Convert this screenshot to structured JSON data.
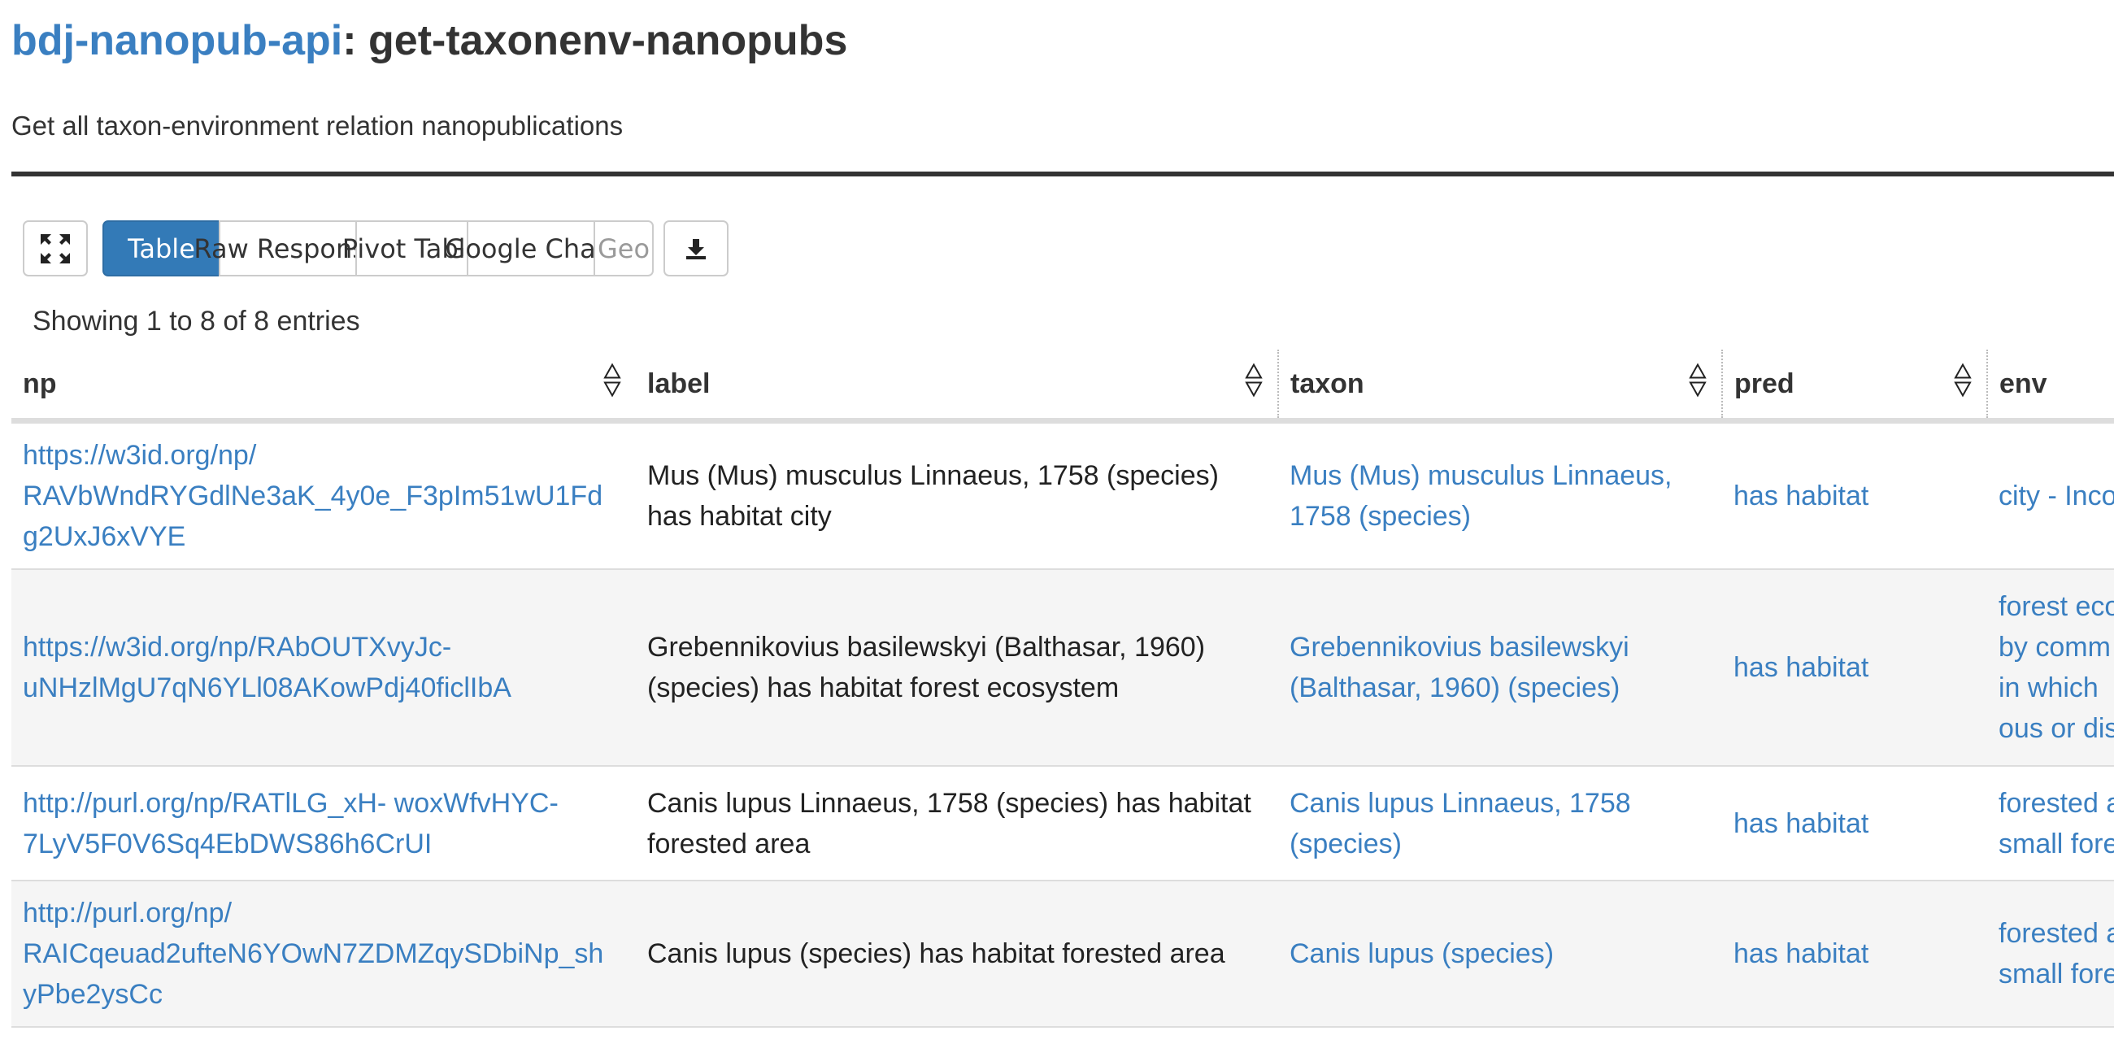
{
  "header": {
    "api_name": "bdj-nanopub-api",
    "separator": ": ",
    "query_name": "get-taxonenv-nanopubs",
    "description": "Get all taxon-environment relation nanopublications"
  },
  "toolbar": {
    "fullscreen_icon": "expand-arrows-icon",
    "tabs": [
      "Table",
      "Raw Response",
      "Pivot Table",
      "Google Chart",
      "Geo"
    ],
    "active_tab": "Table",
    "disabled_tab": "Geo",
    "download_icon": "download-icon"
  },
  "table": {
    "info": "Showing 1 to 8 of 8 entries",
    "columns": [
      "np",
      "label",
      "taxon",
      "pred",
      "env"
    ],
    "rows": [
      {
        "np": "https://w3id.org/np/ RAVbWndRYGdlNe3aK_4y0e_F3pIm51wU1Fd g2UxJ6xVYE",
        "label": "Mus (Mus) musculus Linnaeus, 1758 (species) has habitat city",
        "taxon": "Mus (Mus) musculus Linnaeus, 1758 (species)",
        "pred": "has habitat",
        "env": "city - Inco"
      },
      {
        "np": "https://w3id.org/np/RAbOUTXvyJc- uNHzlMgU7qN6YLl08AKowPdj40ficlIbA",
        "label": "Grebennikovius basilewskyi (Balthasar, 1960) (species) has habitat forest ecosystem",
        "taxon": "Grebennikovius basilewskyi (Balthasar, 1960) (species)",
        "pred": "has habitat",
        "env": "forest eco by comm in which ous or dis"
      },
      {
        "np": "http://purl.org/np/RATlLG_xH- woxWfvHYC-7LyV5F0V6Sq4EbDWS86h6CrUI",
        "label": "Canis lupus Linnaeus, 1758 (species) has habitat forested area",
        "taxon": "Canis lupus Linnaeus, 1758 (species)",
        "pred": "has habitat",
        "env": "forested a small fore"
      },
      {
        "np": "http://purl.org/np/ RAICqeuad2ufteN6YOwN7ZDMZqySDbiNp_sh yPbe2ysCc",
        "label": "Canis lupus (species) has habitat forested area",
        "taxon": "Canis lupus (species)",
        "pred": "has habitat",
        "env": "forested a small fore"
      }
    ]
  }
}
